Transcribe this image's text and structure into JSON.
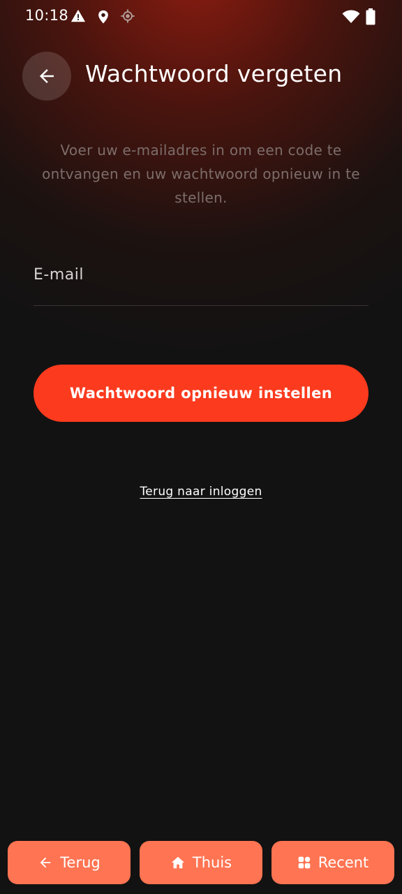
{
  "status_bar": {
    "time": "10:18",
    "left_icons": [
      "warning-icon",
      "location-pin-icon",
      "gps-icon"
    ],
    "right_icons": [
      "wifi-icon",
      "battery-icon"
    ]
  },
  "header": {
    "back_icon": "arrow-left-icon",
    "title": "Wachtwoord vergeten"
  },
  "form": {
    "description": "Voer uw e-mailadres in om een code te ontvangen en uw wachtwoord opnieuw in te stellen.",
    "email_placeholder": "E-mail",
    "email_value": "",
    "submit_label": "Wachtwoord opnieuw instellen",
    "back_to_login_label": "Terug naar inloggen"
  },
  "bottom_nav": {
    "back_label": "Terug",
    "home_label": "Thuis",
    "recent_label": "Recent"
  },
  "colors": {
    "accent": "#fb3a1e",
    "nav_button": "#ff7452",
    "background": "#121212"
  }
}
